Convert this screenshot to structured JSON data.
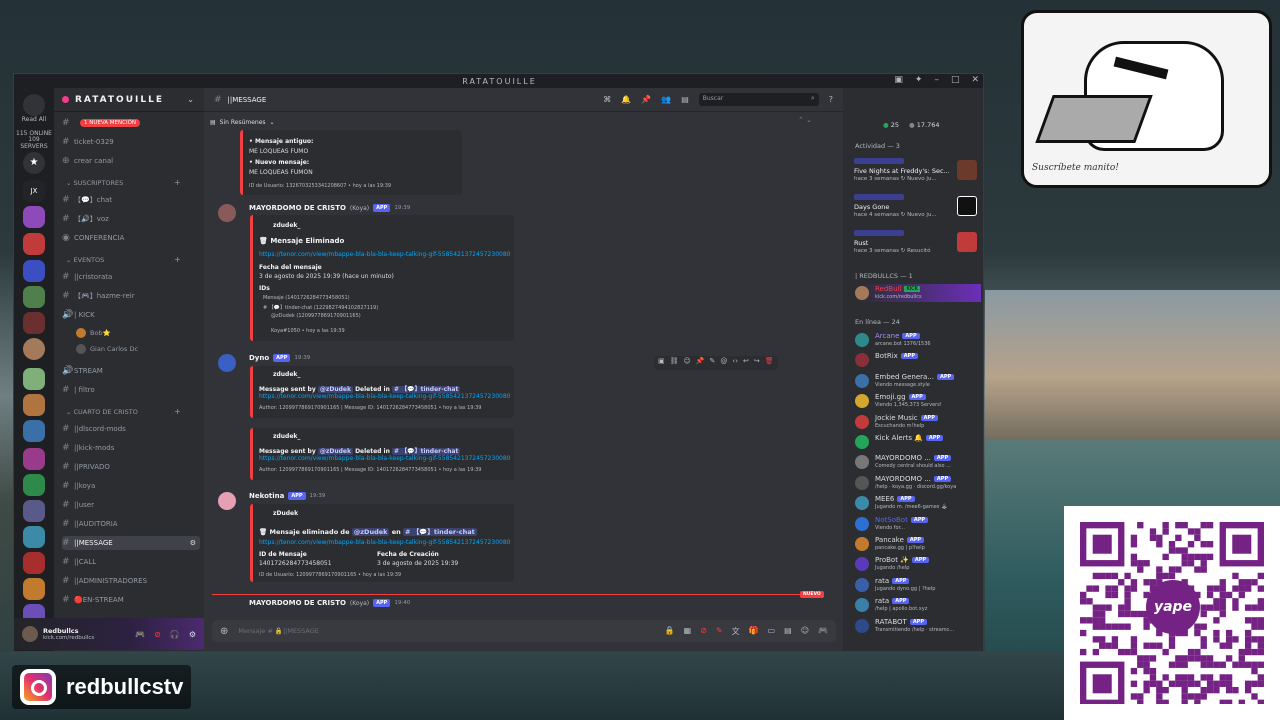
{
  "window": {
    "title": "RATATOUILLE"
  },
  "guilds": {
    "read_all": "Read All",
    "online": "115 ONLINE",
    "servers": "109 SERVERS",
    "jx": "JX"
  },
  "server": {
    "name": "RATATOUILLE"
  },
  "channels": {
    "new_mention": "1 NUEVA MENCIÓN",
    "ticket": "ticket-0329",
    "create": "crear canal",
    "cat_subs": "SUSCRIPTORES",
    "chat": "【💬】chat",
    "voz": "【🔊】voz",
    "conferencia": "CONFERENCIA",
    "cat_events": "EVENTOS",
    "cristorata": "||cristorata",
    "hazme": "【🎮】hazme-reir",
    "kick": "| KICK",
    "m1": "Bob⭐",
    "m2": "Gian Carlos Dc",
    "stream": "STREAM",
    "filtro": "| filtro",
    "cat_cuarto": "CUARTO DE CRISTO",
    "dc_mods": "||dlscord-mods",
    "kick_mods": "||kick-mods",
    "privado": "||PRIVADO",
    "koya": "||koya",
    "user": "||user",
    "auditoria": "||AUDITORIA",
    "message": "||MESSAGE",
    "call": "||CALL",
    "admins": "||ADMINISTRADORES",
    "enstream": "🔴EN-STREAM"
  },
  "user": {
    "name": "Redbullcs",
    "status": "kick.com/redbullcs"
  },
  "header": {
    "channel": "||MESSAGE",
    "search_placeholder": "Buscar",
    "summaries": "Sin Resúmenes"
  },
  "messages": {
    "top": {
      "old_label": "Mensaje antiguo:",
      "old_text": "ME LOQUEAS FUMO",
      "new_label": "Nuevo mensaje:",
      "new_text": "ME LOQUEAS FUMON",
      "footer": "ID de Usuario: 1326703253341208607 • hoy a las 19:39"
    },
    "m1": {
      "author": "MAYORDOMO DE CRISTO",
      "tag": "(Koya)",
      "app": "APP",
      "time": "19:39",
      "user": "zdudek_",
      "title": "🗑 Mensaje Eliminado",
      "link": "https://tenor.com/view/mbappe-bla-bla-bla-keep-talking-gif-5585421372457230080",
      "date_label": "Fecha del mensaje",
      "date_val": "3 de agosto de 2025 19:39 (hace un minuto)",
      "ids_label": "IDs",
      "ids1": "Mensaje (1401726284773458051)",
      "ids2": "# 【💬】tinder-chat (1229827494102827119)",
      "ids3": "@zDudek (1209977869170901165)",
      "footer": "Koya#1050 • hoy a las 19:39"
    },
    "m2": {
      "author": "Dyno",
      "app": "APP",
      "time": "19:39",
      "user": "zdudek_",
      "sent": "Message sent by",
      "mention": "@zDudek",
      "deleted": "Deleted in",
      "channel": "# 【💬】tinder-chat",
      "link": "https://tenor.com/view/mbappe-bla-bla-bla-keep-talking-gif-5585421372457230080",
      "footer": "Author: 1209977869170901165 | Message ID: 1401726284773458051 • hoy a las 19:39"
    },
    "m3": {
      "user": "zdudek_",
      "sent": "Message sent by",
      "mention": "@zDudek",
      "deleted": "Deleted in",
      "channel": "# 【💬】tinder-chat",
      "link": "https://tenor.com/view/mbappe-bla-bla-bla-keep-talking-gif-5585421372457230080",
      "footer": "Author: 1209977869170901165 | Message ID: 1401726284773458051 • hoy a las 19:39"
    },
    "m4": {
      "author": "Nekotina",
      "app": "APP",
      "time": "19:39",
      "user": "zDudek",
      "title_a": "Mensaje eliminado de",
      "mention": "@zDudek",
      "title_b": "en",
      "channel": "# 【💬】tinder-chat",
      "link": "https://tenor.com/view/mbappe-bla-bla-bla-keep-talking-gif-5585421372457230080",
      "id_label": "ID de Mensaje",
      "id_val": "1401726284773458051",
      "date_label": "Fecha de Creación",
      "date_val": "3 de agosto de 2025 19:39",
      "footer": "ID de Usuario: 1209977869170901165 • hoy a las 19:39"
    },
    "m5": {
      "author": "MAYORDOMO DE CRISTO",
      "tag": "(Koya)",
      "app": "APP",
      "time": "19:40"
    },
    "new_label": "NUEVO"
  },
  "composer": {
    "placeholder": "Mensaje # 🔒||MESSAGE"
  },
  "members": {
    "online_count": "25",
    "total_count": "17.764",
    "activity_label": "Actividad — 3",
    "activities": [
      {
        "game": "Five Nights at Freddy's: Sec...",
        "when": "hace 3 semanas  ↻ Nuevo ju..."
      },
      {
        "game": "Days Gone",
        "when": "hace 4 semanas  ↻ Nuevo ju..."
      },
      {
        "game": "Rust",
        "when": "hace 3 semanas  ↻ Resucitó"
      }
    ],
    "role_red": "| REDBULLCS — 1",
    "red_member": {
      "name": "RedBull",
      "badge": "KICK",
      "status": "kick.com/redbullcs"
    },
    "online_label": "En línea — 24",
    "list": [
      {
        "name": "Arcane",
        "app": "APP",
        "status": "arcane.bot 1376/1536"
      },
      {
        "name": "BotRix",
        "app": "APP",
        "status": ""
      },
      {
        "name": "Embed Genera...",
        "app": "APP",
        "status": "Viendo message.style"
      },
      {
        "name": "Emoji.gg",
        "app": "APP",
        "status": "Viendo 1,345,373 Servers!"
      },
      {
        "name": "Jockie Music",
        "app": "APP",
        "status": "Escuchando m!help"
      },
      {
        "name": "Kick Alerts 🔔",
        "app": "APP",
        "status": ""
      },
      {
        "name": "MAYORDOMO ...",
        "app": "APP",
        "status": "Comedy central should also ..."
      },
      {
        "name": "MAYORDOMO ...",
        "app": "APP",
        "status": "/help · koya.gg · discord.gg/koya"
      },
      {
        "name": "MEE6",
        "app": "APP",
        "status": "Jugando m. /mee6-games 🕹"
      },
      {
        "name": "NotSoBot",
        "app": "APP",
        "status": "Viendo for..."
      },
      {
        "name": "Pancake",
        "app": "APP",
        "status": "pancake.gg | p!help"
      },
      {
        "name": "ProBot ✨",
        "app": "APP",
        "status": "Jugando /help"
      },
      {
        "name": "rata",
        "app": "APP",
        "status": "Jugando dyno.gg | ?help"
      },
      {
        "name": "rata",
        "app": "APP",
        "status": "/help | apollo.bot.xyz"
      },
      {
        "name": "RATABOT",
        "app": "APP",
        "status": "Transmitiendo /help · streamc..."
      }
    ]
  },
  "overlay": {
    "instagram": "redbullcstv",
    "qr_brand": "yape",
    "sticker_text": "Suscríbete manito!"
  },
  "colors": {
    "blurple": "#5865f2",
    "red": "#f23f42",
    "green": "#23a55a",
    "link": "#00a8fc"
  }
}
